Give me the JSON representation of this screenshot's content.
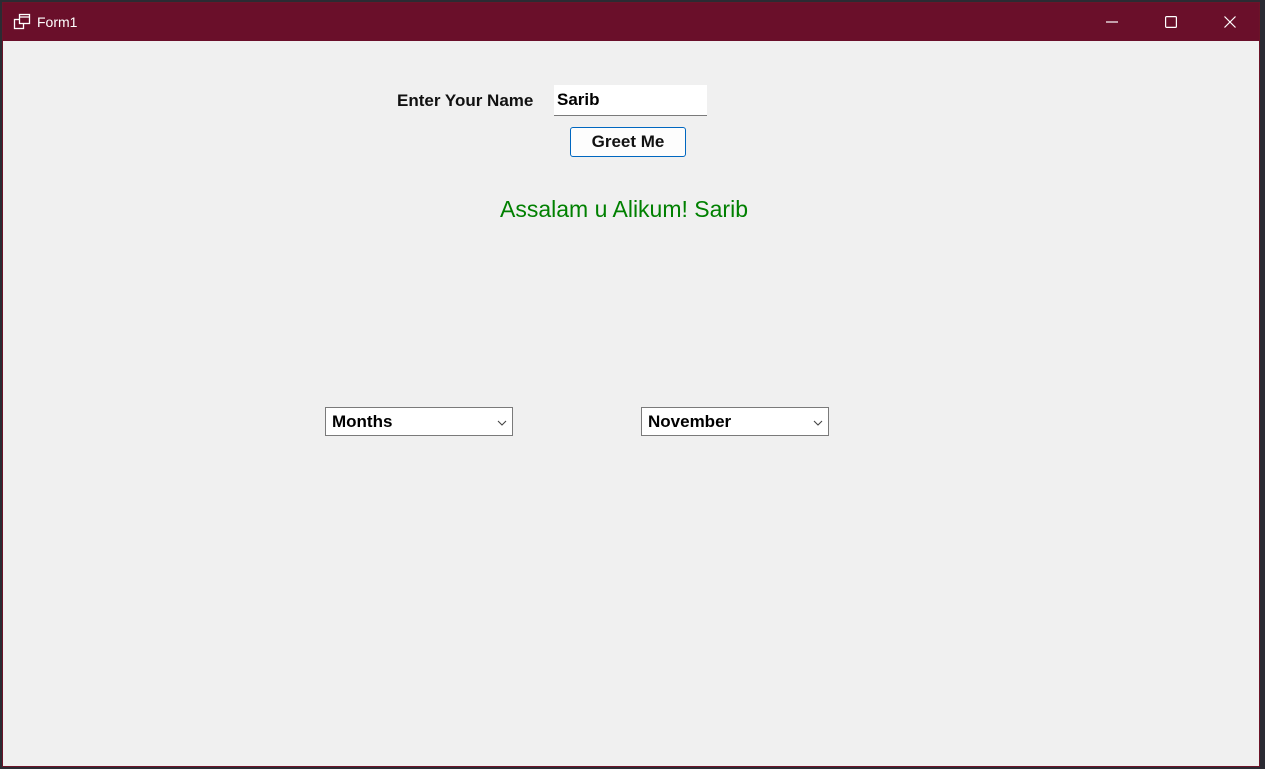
{
  "window": {
    "title": "Form1",
    "titlebar_color": "#6a0f2a",
    "background_color": "#f0f0f0",
    "icons": {
      "app": "app-window-icon",
      "minimize": "minimize-icon",
      "maximize": "maximize-icon",
      "close": "close-icon"
    }
  },
  "form": {
    "name_label": "Enter Your Name",
    "name_value": "Sarib",
    "greet_button_label": "Greet Me",
    "greeting_text": "Assalam u Alikum! Sarib",
    "greeting_color": "#008000",
    "months_combo": {
      "selected": "Months"
    },
    "month_combo": {
      "selected": "November"
    }
  }
}
